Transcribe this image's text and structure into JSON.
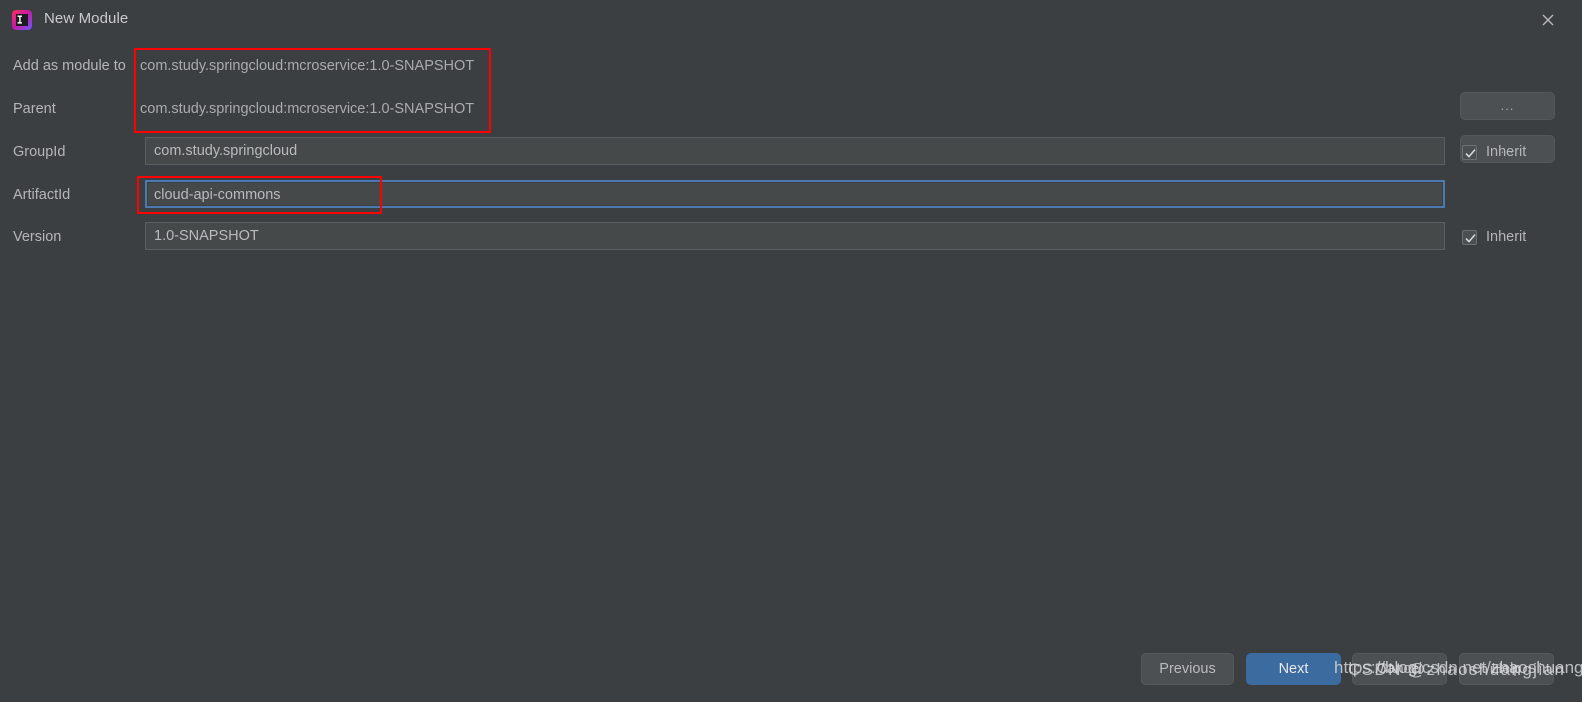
{
  "window": {
    "title": "New Module",
    "app_icon": "intellij-idea-icon",
    "close_icon": "close-icon",
    "background_color": "#3c3f41"
  },
  "form": {
    "rows": [
      {
        "label": "Add as module to",
        "value": "com.study.springcloud:mcroservice:1.0-SNAPSHOT",
        "type": "plain",
        "browse_label": "...",
        "has_browse": true,
        "has_inherit": false
      },
      {
        "label": "Parent",
        "value": "com.study.springcloud:mcroservice:1.0-SNAPSHOT",
        "type": "plain",
        "browse_label": "...",
        "has_browse": true,
        "has_inherit": false
      },
      {
        "label": "GroupId",
        "value": "com.study.springcloud",
        "type": "input",
        "has_browse": false,
        "has_inherit": true,
        "inherit_label": "Inherit",
        "inherit_checked": true
      },
      {
        "label": "ArtifactId",
        "value": "cloud-api-commons",
        "type": "input",
        "focused": true,
        "has_browse": false,
        "has_inherit": false
      },
      {
        "label": "Version",
        "value": "1.0-SNAPSHOT",
        "type": "input",
        "has_browse": false,
        "has_inherit": true,
        "inherit_label": "Inherit",
        "inherit_checked": true
      }
    ]
  },
  "footer": {
    "previous_label": "Previous",
    "next_label": "Next",
    "cancel_label": "Cancel",
    "help_label": "Help"
  },
  "annotations": {
    "highlight_color": "#ff0000",
    "boxes": [
      {
        "name": "parent-coordinates-highlight"
      },
      {
        "name": "artifactid-highlight"
      }
    ]
  },
  "watermark": {
    "line_a": "https://blog.csdn.net/zhaoshuangjian",
    "line_b": "CSDN @zhaoshuangjian"
  }
}
